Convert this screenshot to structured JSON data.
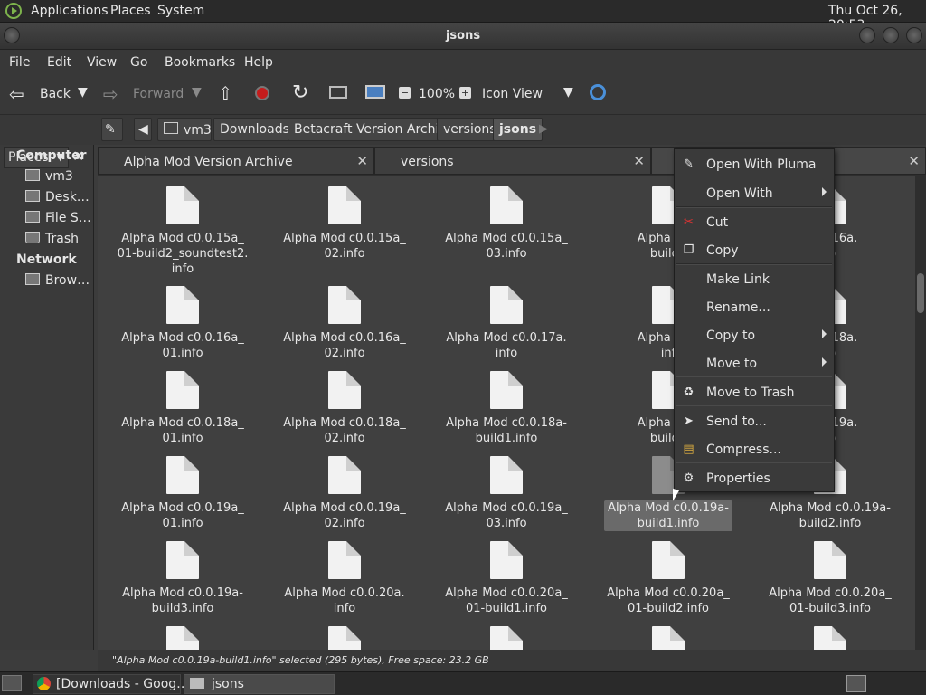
{
  "top_panel": {
    "menus": [
      "Applications",
      "Places",
      "System"
    ],
    "clock": "Thu Oct 26, 20:53"
  },
  "window": {
    "title": "jsons"
  },
  "menubar": {
    "items": [
      "File",
      "Edit",
      "View",
      "Go",
      "Bookmarks",
      "Help"
    ]
  },
  "toolbar": {
    "back": "Back",
    "forward": "Forward",
    "zoom": "100%",
    "view_mode": "Icon View"
  },
  "location": {
    "crumbs": [
      "vm3",
      "Downloads",
      "Betacraft Version Archive",
      "versions",
      "jsons"
    ]
  },
  "sidebar": {
    "header": "Places",
    "sections": [
      {
        "title": "Computer",
        "items": [
          "vm3",
          "Desk…",
          "File S…",
          "Trash"
        ]
      },
      {
        "title": "Network",
        "items": [
          "Brow…"
        ]
      }
    ]
  },
  "tabs": [
    "Alpha Mod Version Archive",
    "versions",
    ""
  ],
  "files": [
    [
      "Alpha Mod c0.0.15a_",
      "01-build2_soundtest2.",
      "info"
    ],
    [
      "Alpha Mod c0.0.15a_",
      "02.info"
    ],
    [
      "Alpha Mod c0.0.15a_",
      "03.info"
    ],
    [
      "Alpha Mod",
      "build1"
    ],
    [
      "",
      "c0.0.16a.",
      "fo"
    ],
    [
      "Alpha Mod c0.0.16a_",
      "01.info"
    ],
    [
      "Alpha Mod c0.0.16a_",
      "02.info"
    ],
    [
      "Alpha Mod c0.0.17a.",
      "info"
    ],
    [
      "Alpha Mod",
      "inf"
    ],
    [
      "",
      "c0.0.18a.",
      "fo"
    ],
    [
      "Alpha Mod c0.0.18a_",
      "01.info"
    ],
    [
      "Alpha Mod c0.0.18a_",
      "02.info"
    ],
    [
      "Alpha Mod c0.0.18a-",
      "build1.info"
    ],
    [
      "Alpha Mod",
      "build2"
    ],
    [
      "",
      "c0.0.19a.",
      "fo"
    ],
    [
      "Alpha Mod c0.0.19a_",
      "01.info"
    ],
    [
      "Alpha Mod c0.0.19a_",
      "02.info"
    ],
    [
      "Alpha Mod c0.0.19a_",
      "03.info"
    ],
    [
      "Alpha Mod c0.0.19a-",
      "build1.info"
    ],
    [
      "Alpha Mod c0.0.19a-",
      "build2.info"
    ],
    [
      "Alpha Mod c0.0.19a-",
      "build3.info"
    ],
    [
      "Alpha Mod c0.0.20a.",
      "info"
    ],
    [
      "Alpha Mod c0.0.20a_",
      "01-build1.info"
    ],
    [
      "Alpha Mod c0.0.20a_",
      "01-build2.info"
    ],
    [
      "Alpha Mod c0.0.20a_",
      "01-build3.info"
    ],
    [
      ""
    ],
    [
      ""
    ],
    [
      ""
    ],
    [
      ""
    ],
    [
      ""
    ]
  ],
  "status": "\"Alpha Mod c0.0.19a-build1.info\" selected (295 bytes), Free space: 23.2 GB",
  "context_menu": [
    {
      "label": "Open With Pluma",
      "icon": "pluma-icon"
    },
    {
      "label": "Open With",
      "submenu": true
    },
    {
      "label": "Cut",
      "icon": "scissors-icon"
    },
    {
      "label": "Copy",
      "icon": "copy-icon"
    },
    {
      "label": "Make Link"
    },
    {
      "label": "Rename..."
    },
    {
      "label": "Copy to",
      "submenu": true
    },
    {
      "label": "Move to",
      "submenu": true
    },
    {
      "label": "Move to Trash",
      "icon": "trash-icon"
    },
    {
      "label": "Send to...",
      "icon": "send-icon"
    },
    {
      "label": "Compress...",
      "icon": "archive-icon"
    },
    {
      "label": "Properties",
      "icon": "properties-icon"
    }
  ],
  "taskbar": {
    "tasks": [
      "[Downloads - Goog…",
      "jsons"
    ]
  }
}
